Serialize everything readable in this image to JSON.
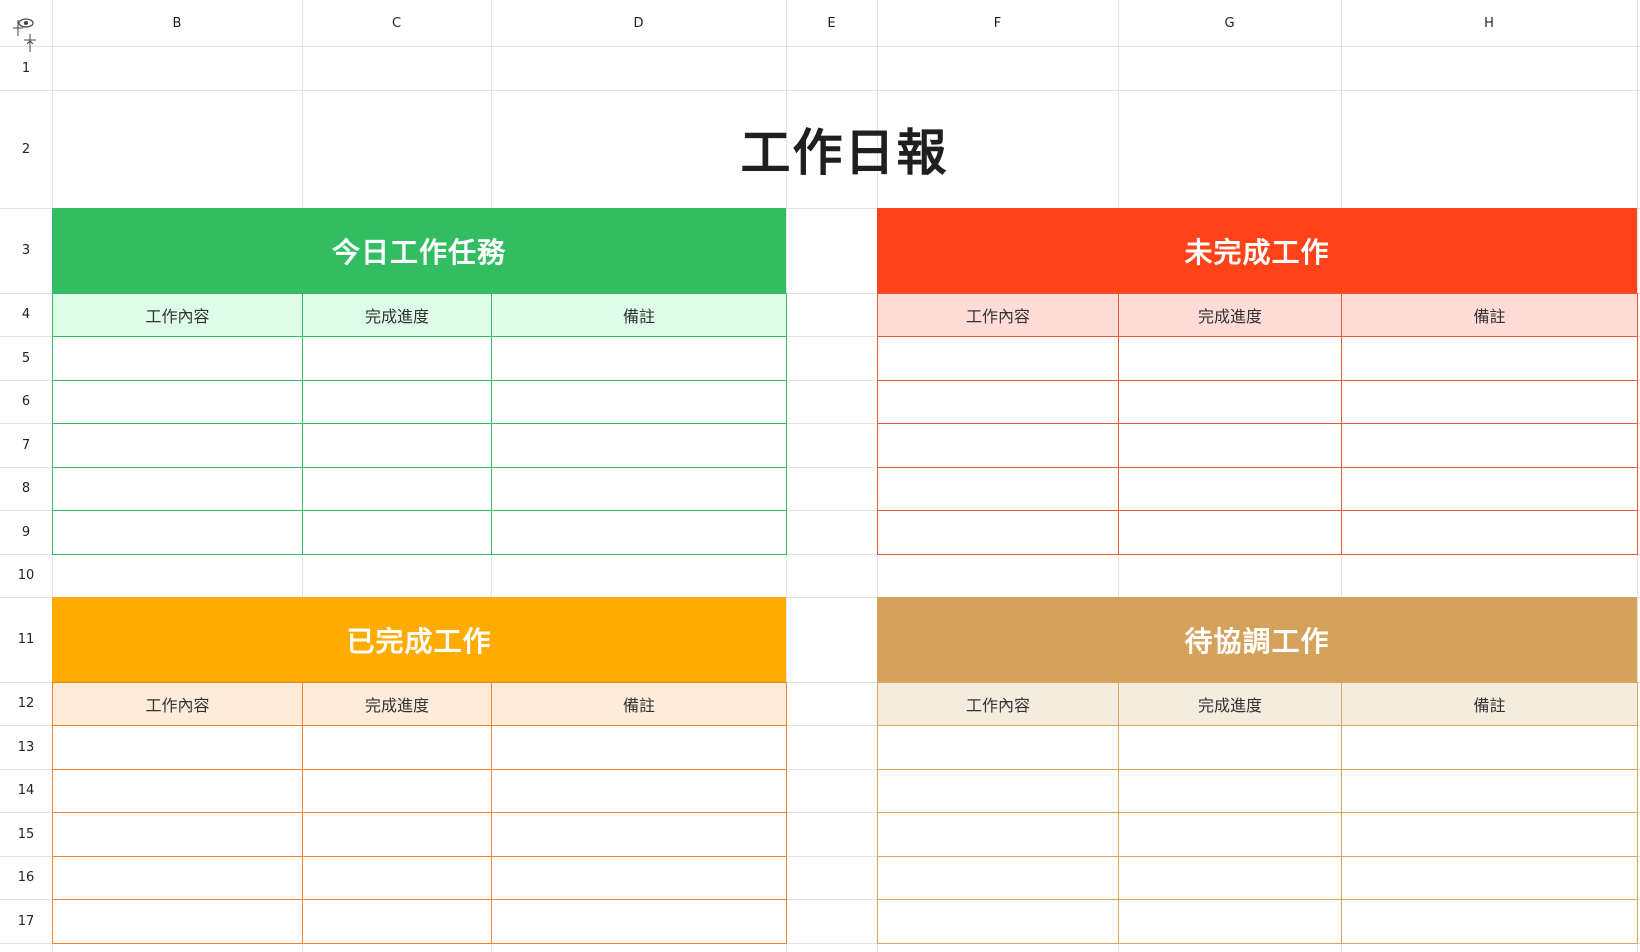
{
  "columns": [
    "B",
    "C",
    "D",
    "E",
    "F",
    "G",
    "H"
  ],
  "rows": [
    "1",
    "2",
    "3",
    "4",
    "5",
    "6",
    "7",
    "8",
    "9",
    "10",
    "11",
    "12",
    "13",
    "14",
    "15",
    "16",
    "17"
  ],
  "title": "工作日報",
  "blocks": [
    {
      "title": "今日工作任務",
      "headers": [
        "工作內容",
        "完成進度",
        "備註"
      ],
      "color": "#33bd63",
      "header_bg": "#ddfde9",
      "line": "#33bd63"
    },
    {
      "title": "未完成工作",
      "headers": [
        "工作內容",
        "完成進度",
        "備註"
      ],
      "color": "#ff4217",
      "header_bg": "#ffdcd8",
      "line": "#ea5a3a"
    },
    {
      "title": "已完成工作",
      "headers": [
        "工作內容",
        "完成進度",
        "備註"
      ],
      "color": "#ffab00",
      "header_bg": "#feecd8",
      "line": "#f4832e"
    },
    {
      "title": "待協調工作",
      "headers": [
        "工作內容",
        "完成進度",
        "備註"
      ],
      "color": "#d5a25b",
      "header_bg": "#f6ebdf",
      "line": "#d9a763"
    }
  ],
  "colors": {
    "grid": "#e3e3e3",
    "text": "#222222"
  },
  "icons": {
    "corner": "freeze-panes-icon"
  }
}
